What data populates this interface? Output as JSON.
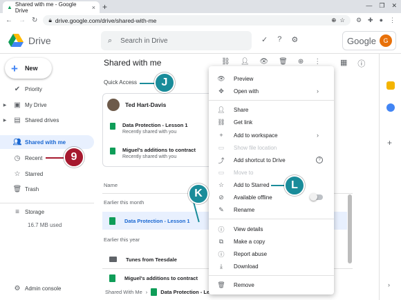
{
  "browser": {
    "tab_title": "Shared with me - Google Drive",
    "url": "drive.google.com/drive/shared-with-me"
  },
  "header": {
    "logo_text": "Drive",
    "search_placeholder": "Search in Drive",
    "google_label": "Google",
    "avatar_letter": "G"
  },
  "sidebar": {
    "new_label": "New",
    "items": [
      {
        "label": "Priority"
      },
      {
        "label": "My Drive"
      },
      {
        "label": "Shared drives"
      },
      {
        "label": "Shared with me"
      },
      {
        "label": "Recent"
      },
      {
        "label": "Starred"
      },
      {
        "label": "Trash"
      },
      {
        "label": "Storage"
      },
      {
        "label": "Admin console"
      }
    ],
    "storage_used": "16.7 MB used"
  },
  "main": {
    "title": "Shared with me",
    "quick_access_label": "Quick Access",
    "qa_user": "Ted Hart-Davis",
    "qa_files": [
      {
        "name": "Data Protection - Lesson 1",
        "sub": "Recently shared with you"
      },
      {
        "name": "Miguel's additions to contract",
        "sub": "Recently shared with you"
      }
    ],
    "name_header": "Name",
    "earlier_month": "Earlier this month",
    "earlier_year": "Earlier this year",
    "files": [
      {
        "name": "Data Protection - Lesson 1"
      },
      {
        "name": "Tunes from Teesdale"
      },
      {
        "name": "Miguel's additions to contract"
      }
    ],
    "breadcrumb_root": "Shared With Me",
    "breadcrumb_current": "Data Protection - Lesso"
  },
  "context_menu": {
    "preview": "Preview",
    "open_with": "Open with",
    "share": "Share",
    "get_link": "Get link",
    "add_to_workspace": "Add to workspace",
    "show_file_location": "Show file location",
    "add_shortcut": "Add shortcut to Drive",
    "move_to": "Move to",
    "add_to_starred": "Add to Starred",
    "available_offline": "Available offline",
    "rename": "Rename",
    "view_details": "View details",
    "make_copy": "Make a copy",
    "report_abuse": "Report abuse",
    "download": "Download",
    "remove": "Remove"
  },
  "callouts": {
    "j": "J",
    "k": "K",
    "l": "L",
    "nine": "9"
  },
  "colors": {
    "callout_teal": "#1a8c9a",
    "callout_red": "#a6192e",
    "accent_blue": "#1967d2"
  }
}
